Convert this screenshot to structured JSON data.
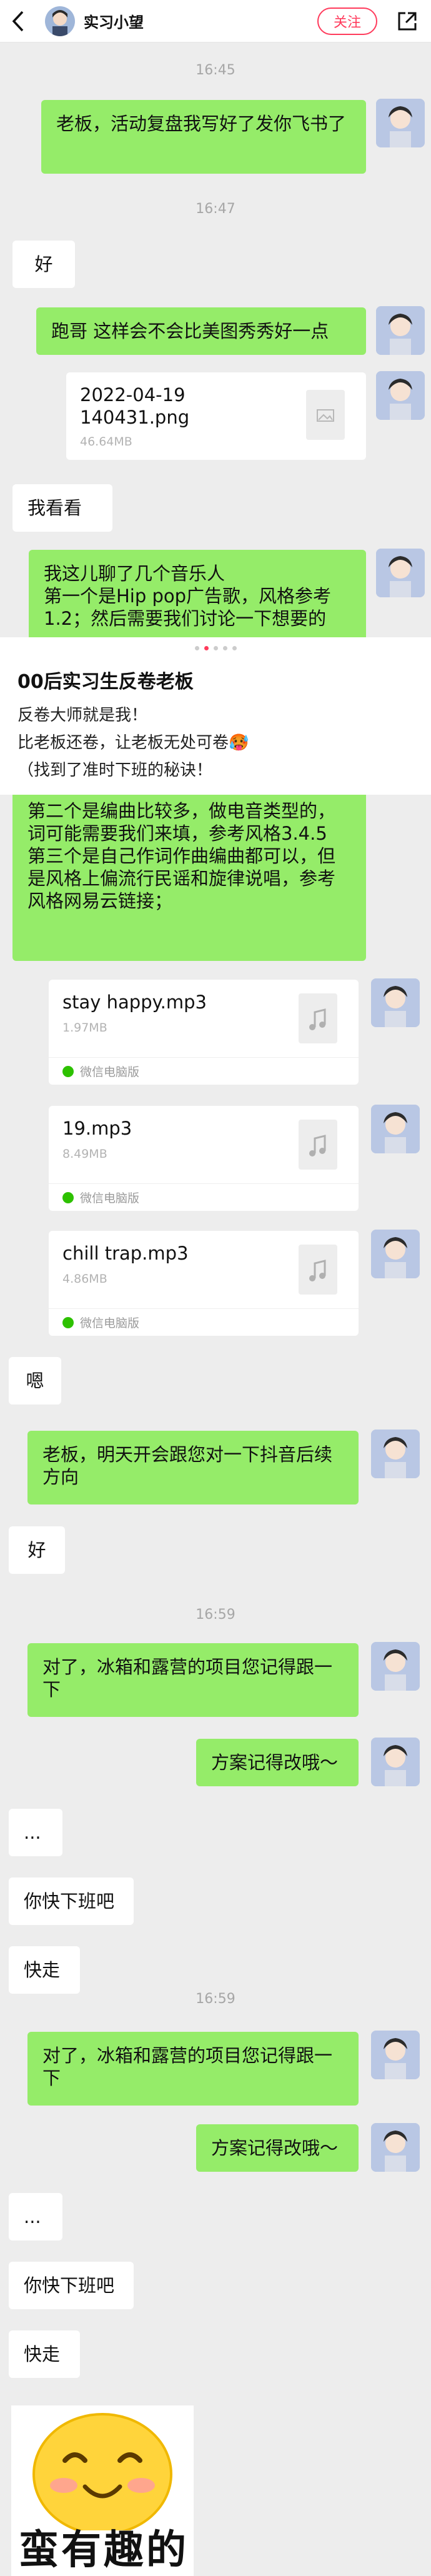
{
  "header": {
    "contact_name": "实习小望",
    "follow_label": "关注"
  },
  "timestamps": [
    "16:45",
    "16:47",
    "16:59",
    "16:59"
  ],
  "messages": {
    "m1": "老板，活动复盘我写好了发你飞书了",
    "m2": "好",
    "m3": "跑哥 这样会不会比美图秀秀好一点",
    "m4": "我看看",
    "m5": "我这儿聊了几个音乐人\n第一个是Hip pop广告歌，风格参考1.2；然后需要我们讨论一下想要的",
    "m6": "第二个是编曲比较多，做电音类型的，词可能需要我们来填，参考风格3.4.5\n第三个是自己作词作曲编曲都可以，但是风格上偏流行民谣和旋律说唱，参考风格网易云链接；",
    "m7": "嗯",
    "m8": "老板，明天开会跟您对一下抖音后续方向",
    "m9": "好",
    "m10": "对了，冰箱和露营的项目您记得跟一下",
    "m11": "方案记得改哦～",
    "m12": "...",
    "m13": "你快下班吧",
    "m14": "快走",
    "m15": "对了，冰箱和露营的项目您记得跟一下",
    "m16": "方案记得改哦～",
    "m17": "...",
    "m18": "你快下班吧",
    "m19": "快走"
  },
  "files": [
    {
      "name": "2022-04-19\n140431.png",
      "size": "46.64MB",
      "type": "image",
      "footer": ""
    },
    {
      "name": "stay happy.mp3",
      "size": "1.97MB",
      "type": "music",
      "footer": "微信电脑版"
    },
    {
      "name": "19.mp3",
      "size": "8.49MB",
      "type": "music",
      "footer": "微信电脑版"
    },
    {
      "name": "chill trap.mp3",
      "size": "4.86MB",
      "type": "music",
      "footer": "微信电脑版"
    }
  ],
  "post": {
    "title": "00后实习生反卷老板",
    "lines": [
      "反卷大师就是我！",
      "比老板还卷，让老板无处可卷🥵",
      "（找到了准时下班的秘诀！"
    ]
  },
  "sticker": {
    "text": "蛮有趣的",
    "icon": "smiling-face-sticker"
  },
  "colors": {
    "my_bubble": "#95ec69",
    "other_bubble": "#ffffff",
    "background": "#ededed",
    "follow_accent": "#ff3b5c"
  }
}
